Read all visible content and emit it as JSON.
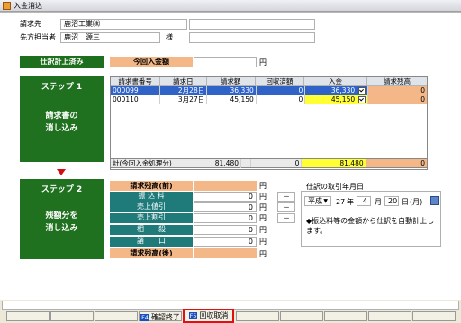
{
  "window": {
    "title": "入金消込"
  },
  "header": {
    "customer_label": "請求先",
    "customer_value": "鹿沼工業㈱",
    "contact_label": "先方担当者",
    "contact_value": "鹿沼　源三",
    "honorific": "様"
  },
  "status_label": "仕訳計上済み",
  "payment": {
    "label": "今回入金額",
    "value": "",
    "unit": "円"
  },
  "step1": {
    "title": "ステップ 1",
    "desc_line1": "請求書の",
    "desc_line2": "消し込み"
  },
  "table": {
    "headers": [
      "請求書番号",
      "請求日",
      "請求額",
      "回収済額",
      "入金",
      "請求残高"
    ],
    "rows": [
      {
        "no": "000099",
        "date": "2月28日",
        "amount": "36,330",
        "collected": "0",
        "payment": "36,330",
        "balance": "0",
        "checked": true
      },
      {
        "no": "000110",
        "date": "3月27日",
        "amount": "45,150",
        "collected": "0",
        "payment": "45,150",
        "balance": "0",
        "checked": true
      }
    ],
    "total_label": "計(今回入金処理分)",
    "total_amount": "81,480",
    "total_collected": "0",
    "total_payment": "81,480",
    "total_balance": "0"
  },
  "step2": {
    "title": "ステップ 2",
    "desc_line1": "残額分を",
    "desc_line2": "消し込み",
    "rows": [
      {
        "label": "請求残高(前)",
        "value": "",
        "unit": "円",
        "dash": ""
      },
      {
        "label": "振 込 料",
        "value": "0",
        "unit": "円",
        "dash": "－"
      },
      {
        "label": "売上値引",
        "value": "0",
        "unit": "円",
        "dash": "－"
      },
      {
        "label": "売上割引",
        "value": "0",
        "unit": "円",
        "dash": "－"
      },
      {
        "label": "相　　殺",
        "value": "0",
        "unit": "円",
        "dash": ""
      },
      {
        "label": "諸　　口",
        "value": "0",
        "unit": "円",
        "dash": ""
      },
      {
        "label": "請求残高(後)",
        "value": "",
        "unit": "円",
        "dash": ""
      }
    ]
  },
  "journal_date": {
    "label": "仕訳の取引年月日",
    "era": "平成",
    "year": "27",
    "year_unit": "年",
    "month": "4",
    "month_unit": "月",
    "day": "20",
    "day_unit": "日",
    "weekday": "(月)",
    "note": "◆振込料等の金額から仕訳を自動計上します。"
  },
  "footer": {
    "buttons": [
      {
        "key": "F4",
        "label": "確認終了"
      },
      {
        "key": "F5",
        "label": "回収取消"
      }
    ]
  },
  "colors": {
    "highlight_border": "#e01010",
    "step_green": "#1f701f",
    "selection_blue": "#2f63c8"
  }
}
